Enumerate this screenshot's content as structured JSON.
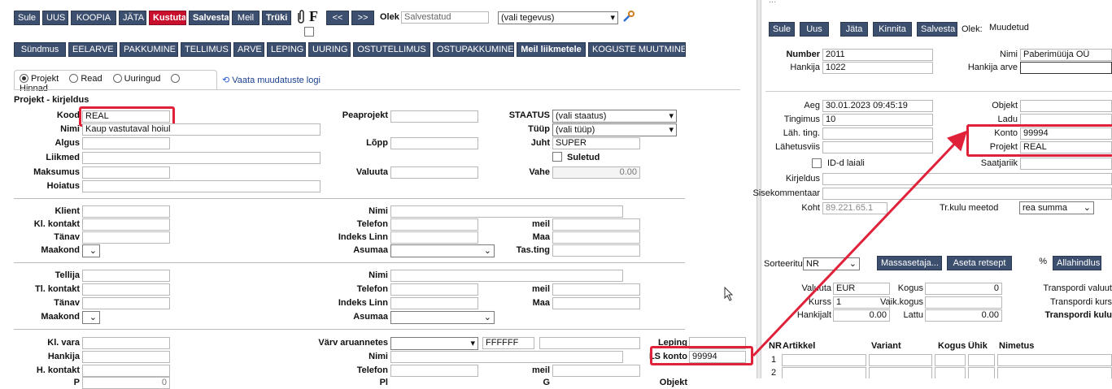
{
  "left": {
    "toolbar": {
      "buttons": [
        "Sule",
        "UUS",
        "KOOPIA",
        "JÄTA",
        "Kustuta",
        "Salvesta",
        "Meil",
        "Trüki"
      ],
      "attach_icon": "paperclip-icon",
      "f_label": "F",
      "prev": "<<",
      "next": ">>",
      "olek_label": "Olek",
      "olek_value": "Salvestatud",
      "activity_select": "(vali tegevus)",
      "tool_icon": "wrench-icon"
    },
    "doc_buttons": [
      "Sündmus",
      "EELARVE",
      "PAKKUMINE",
      "TELLIMUS",
      "ARVE",
      "LEPING",
      "UURING",
      "OSTUTELLIMUS",
      "OSTUPAKKUMINE",
      "Meil liikmetele",
      "KOGUSTE MUUTMINE"
    ],
    "tabs": {
      "projekt": "Projekt",
      "read": "Read",
      "uuringud": "Uuringud",
      "hinnad": "Hinnad",
      "log_link": "Vaata muudatuste logi"
    },
    "section_title": "Projekt - kirjeldus",
    "fields": {
      "kood_label": "Kood",
      "kood_value": "REAL",
      "nimi_label": "Nimi",
      "nimi_value": "Kaup vastutaval hoiul",
      "algus_label": "Algus",
      "liikmed_label": "Liikmed",
      "maksumus_label": "Maksumus",
      "hoiatus_label": "Hoiatus",
      "peaprojekt_label": "Peaprojekt",
      "lopp_label": "Lõpp",
      "valuuta_label": "Valuuta",
      "staatus_label": "STAATUS",
      "staatus_value": "(vali staatus)",
      "tyyp_label": "Tüüp",
      "tyyp_value": "(vali tüüp)",
      "juht_label": "Juht",
      "juht_value": "SUPER",
      "suletud_label": "Suletud",
      "vahe_label": "Vahe",
      "vahe_value": "0.00",
      "klient_label": "Klient",
      "kl_kontakt_label": "Kl. kontakt",
      "tanav_label": "Tänav",
      "maakond_label": "Maakond",
      "nimi2_label": "Nimi",
      "telefon_label": "Telefon",
      "indeks_label": "Indeks Linn",
      "asumaa_label": "Asumaa",
      "meil_label": "meil",
      "maa_label": "Maa",
      "tasting_label": "Tas.ting",
      "tellija_label": "Tellija",
      "tl_kontakt_label": "Tl. kontakt",
      "kl_vara_label": "Kl. vara",
      "hankija_label": "Hankija",
      "h_kontakt_label": "H. kontakt",
      "varv_label": "Värv aruannetes",
      "varv_value": "FFFFFF",
      "leping_label": "Leping",
      "ls_konto_label": "LS konto",
      "ls_konto_value": "99994",
      "cut_left": "P",
      "cut_left_value": "0",
      "cut_mid": "Pl",
      "cut_right1": "G",
      "cut_right2": "Objekt"
    }
  },
  "right": {
    "top_text": "...",
    "toolbar": [
      "Sule",
      "Uus",
      "Jäta",
      "Kinnita",
      "Salvesta"
    ],
    "olek_label": "Olek:",
    "olek_value": "Muudetud",
    "number_label": "Number",
    "number_value": "2011",
    "nimi_label": "Nimi",
    "nimi_value": "Paberimüüja OÜ",
    "hankija_label": "Hankija",
    "hankija_value": "1022",
    "hankija_arve_label": "Hankija arve",
    "aeg_label": "Aeg",
    "aeg_value": "30.01.2023 09:45:19",
    "objekt_label": "Objekt",
    "tingimus_label": "Tingimus",
    "tingimus_value": "10",
    "ladu_label": "Ladu",
    "lah_ting_label": "Läh. ting.",
    "konto_label": "Konto",
    "konto_value": "99994",
    "lahetusviis_label": "Lähetusviis",
    "projekt_label": "Projekt",
    "projekt_value": "REAL",
    "id_laiali_label": "ID-d laiali",
    "saatjariik_label": "Saatjariik",
    "kirjeldus_label": "Kirjeldus",
    "sisekommentaar_label": "Sisekommentaar",
    "koht_label": "Koht",
    "koht_value": "89.221.65.1",
    "trkulu_label": "Tr.kulu meetod",
    "trkulu_value": "rea summa",
    "sorteeritud_label": "Sorteeritud",
    "sorteeritud_value": "NR",
    "massasetaja": "Massasetaja...",
    "aseta_retsept": "Aseta retsept",
    "percent": "%",
    "allahindlus": "Allahindlus",
    "valuuta_label": "Valuuta",
    "valuuta_value": "EUR",
    "kogus_label": "Kogus",
    "kogus_value": "0",
    "transp_valuuta": "Transpordi valuut",
    "kurss_label": "Kurss",
    "kurss_value": "1",
    "vaik_kogus_label": "Vaik.kogus",
    "transp_kurss": "Transpordi kurs",
    "hankijalt_label": "Hankijalt",
    "hankijalt_value": "0.00",
    "lattu_label": "Lattu",
    "lattu_value": "0.00",
    "transp_kulu": "Transpordi kulu",
    "table_headers": [
      "NR",
      "Artikkel",
      "Variant",
      "Kogus",
      "Ühik",
      "Nimetus"
    ],
    "rows": [
      "1",
      "2"
    ]
  },
  "colors": {
    "button": "#3d4f6e",
    "delete": "#c8102e",
    "highlight": "#e0213a"
  }
}
